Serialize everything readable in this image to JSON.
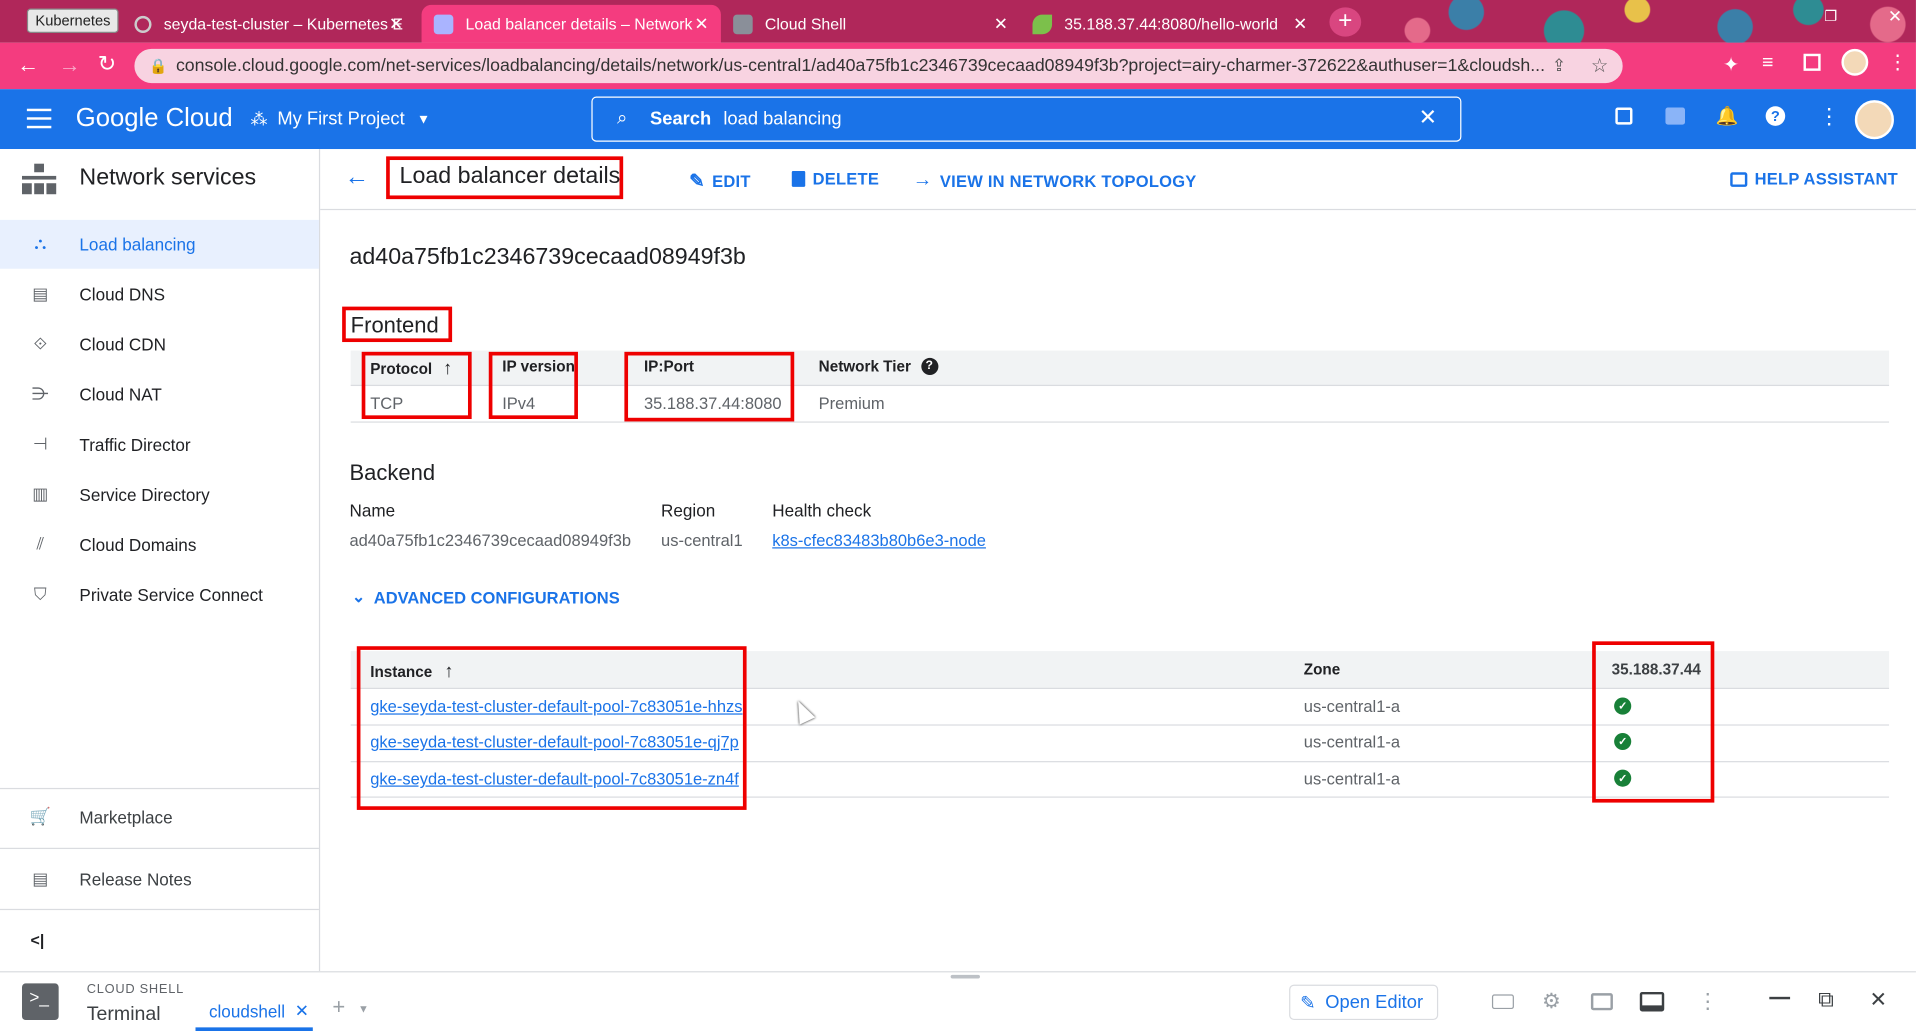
{
  "browser": {
    "pinned_tab_label": "Kubernetes",
    "tabs": [
      {
        "title": "seyda-test-cluster – Kubernetes E"
      },
      {
        "title": "Load balancer details – Network"
      },
      {
        "title": "Cloud Shell"
      },
      {
        "title": "35.188.37.44:8080/hello-world"
      }
    ],
    "url": "console.cloud.google.com/net-services/loadbalancing/details/network/us-central1/ad40a75fb1c2346739cecaad08949f3b?project=airy-charmer-372622&authuser=1&cloudsh..."
  },
  "header": {
    "logo": "Google Cloud",
    "project": "My First Project",
    "search_label": "Search",
    "search_value": "load balancing"
  },
  "sidebar": {
    "title": "Network services",
    "items": [
      {
        "label": "Load balancing",
        "icon": "load-balancing-icon"
      },
      {
        "label": "Cloud DNS",
        "icon": "dns-icon"
      },
      {
        "label": "Cloud CDN",
        "icon": "cdn-icon"
      },
      {
        "label": "Cloud NAT",
        "icon": "nat-icon"
      },
      {
        "label": "Traffic Director",
        "icon": "traffic-director-icon"
      },
      {
        "label": "Service Directory",
        "icon": "service-directory-icon"
      },
      {
        "label": "Cloud Domains",
        "icon": "domains-icon"
      },
      {
        "label": "Private Service Connect",
        "icon": "private-service-connect-icon"
      }
    ],
    "marketplace": "Marketplace",
    "release_notes": "Release Notes",
    "collapse": "<|"
  },
  "toolbar": {
    "title": "Load balancer details",
    "edit": "EDIT",
    "delete": "DELETE",
    "topology": "VIEW IN NETWORK TOPOLOGY",
    "help": "HELP ASSISTANT"
  },
  "lb_name": "ad40a75fb1c2346739cecaad08949f3b",
  "frontend": {
    "heading": "Frontend",
    "headers": [
      "Protocol",
      "IP version",
      "IP:Port",
      "Network Tier"
    ],
    "row": [
      "TCP",
      "IPv4",
      "35.188.37.44:8080",
      "Premium"
    ]
  },
  "backend": {
    "heading": "Backend",
    "headers": [
      "Name",
      "Region",
      "Health check"
    ],
    "row": [
      "ad40a75fb1c2346739cecaad08949f3b",
      "us-central1",
      "k8s-cfec83483b80b6e3-node"
    ],
    "advanced": "ADVANCED CONFIGURATIONS"
  },
  "instances": {
    "headers": [
      "Instance",
      "Zone",
      "35.188.37.44"
    ],
    "rows": [
      {
        "name": "gke-seyda-test-cluster-default-pool-7c83051e-hhzs",
        "zone": "us-central1-a"
      },
      {
        "name": "gke-seyda-test-cluster-default-pool-7c83051e-qj7p",
        "zone": "us-central1-a"
      },
      {
        "name": "gke-seyda-test-cluster-default-pool-7c83051e-zn4f",
        "zone": "us-central1-a"
      }
    ]
  },
  "cloudshell": {
    "label": "CLOUD SHELL",
    "terminal": "Terminal",
    "tab": "cloudshell",
    "open_editor": "Open Editor"
  },
  "colors": {
    "accent": "#1a73e8",
    "annotation": "#e00000",
    "healthy": "#188038"
  }
}
